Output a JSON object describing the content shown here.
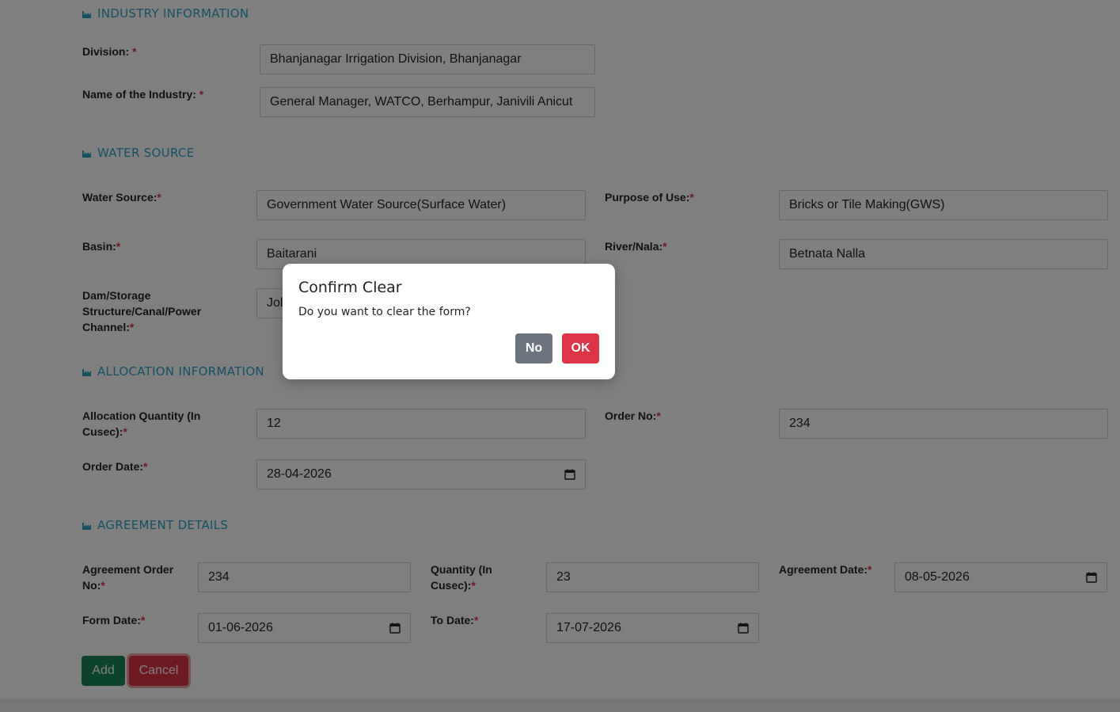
{
  "sections": {
    "industry": "INDUSTRY INFORMATION",
    "water": "WATER SOURCE",
    "allocation": "ALLOCATION INFORMATION",
    "agreement": "AGREEMENT DETAILS"
  },
  "required_mark": "*",
  "industry": {
    "division_label": "Division: ",
    "division_value": "Bhanjanagar Irrigation Division, Bhanjanagar",
    "name_label": "Name of the Industry: ",
    "name_value": "General Manager, WATCO, Berhampur, Janivili Anicut"
  },
  "water": {
    "source_label": "Water Source:",
    "source_value": "Government Water Source(Surface Water)",
    "purpose_label": "Purpose of Use:",
    "purpose_value": "Bricks or Tile Making(GWS)",
    "basin_label": "Basin:",
    "basin_value": "Baitarani",
    "river_label": "River/Nala:",
    "river_value": "Betnata Nalla",
    "dam_label_1": "Dam/Storage",
    "dam_label_2": "Structure/Canal/Power",
    "dam_label_3": "Channel:",
    "dam_value": "Jol"
  },
  "allocation": {
    "qty_label_1": "Allocation Quantity (In",
    "qty_label_2": "Cusec):",
    "qty_value": "12",
    "order_no_label": "Order No:",
    "order_no_value": "234",
    "order_date_label": "Order Date:",
    "order_date_value": "28-04-2026"
  },
  "agreement": {
    "order_no_label_1": "Agreement Order",
    "order_no_label_2": "No:",
    "order_no_value": "234",
    "qty_label_1": "Quantity (In",
    "qty_label_2": "Cusec):",
    "qty_value": "23",
    "date_label": "Agreement Date:",
    "date_value": "08-05-2026",
    "form_date_label": "Form Date:",
    "form_date_value": "01-06-2026",
    "to_date_label": "To Date:",
    "to_date_value": "17-07-2026"
  },
  "buttons": {
    "add": "Add",
    "cancel": "Cancel"
  },
  "modal": {
    "title": "Confirm Clear",
    "message": "Do you want to clear the form?",
    "no": "No",
    "ok": "OK"
  },
  "colors": {
    "section_title": "#2aa3c7",
    "required": "#dc3545",
    "add_button": "#198754",
    "cancel_button": "#dc3545",
    "no_button": "#6c757d",
    "ok_button": "#dc3545"
  }
}
